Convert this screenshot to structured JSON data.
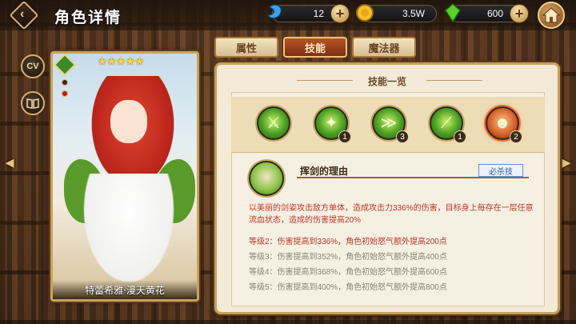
{
  "header": {
    "title": "角色详情",
    "currencies": [
      {
        "name": "gem-blue",
        "value": "12",
        "color": "#3aa0e8"
      },
      {
        "name": "gold",
        "value": "3.5W",
        "color": "#e8b82a"
      },
      {
        "name": "gem-green",
        "value": "600",
        "color": "#5ad02a"
      }
    ]
  },
  "sidebar": {
    "cv_label": "CV"
  },
  "card": {
    "stars": "★★★★★",
    "name": "特蕾希雅·漫天黄花"
  },
  "tabs": [
    {
      "label": "属性",
      "active": false
    },
    {
      "label": "技能",
      "active": true
    },
    {
      "label": "魔法器",
      "active": false
    }
  ],
  "panel": {
    "heading": "技能一览",
    "skills": [
      {
        "icon": "sword-slash-icon",
        "level": ""
      },
      {
        "icon": "star-burst-icon",
        "level": "1"
      },
      {
        "icon": "wind-arrows-icon",
        "level": "3"
      },
      {
        "icon": "green-blade-icon",
        "level": "1"
      },
      {
        "icon": "character-portrait-icon",
        "level": "2",
        "selected": true
      }
    ],
    "selected_skill": {
      "name": "挥剑的理由",
      "tag": "必杀技",
      "description": "以美丽的剑姿攻击敌方单体，造成攻击力336%的伤害，目标身上每存在一层任意流血状态，造成的伤害提高20%",
      "levels": [
        {
          "text": "等级2：伤害提高到336%，角色初始怒气额外提高200点",
          "unlocked": true
        },
        {
          "text": "等级3：伤害提高到352%，角色初始怒气额外提高400点",
          "unlocked": false
        },
        {
          "text": "等级4：伤害提高到368%，角色初始怒气额外提高600点",
          "unlocked": false
        },
        {
          "text": "等级5：伤害提高到400%，角色初始怒气额外提高800点",
          "unlocked": false
        }
      ]
    }
  }
}
